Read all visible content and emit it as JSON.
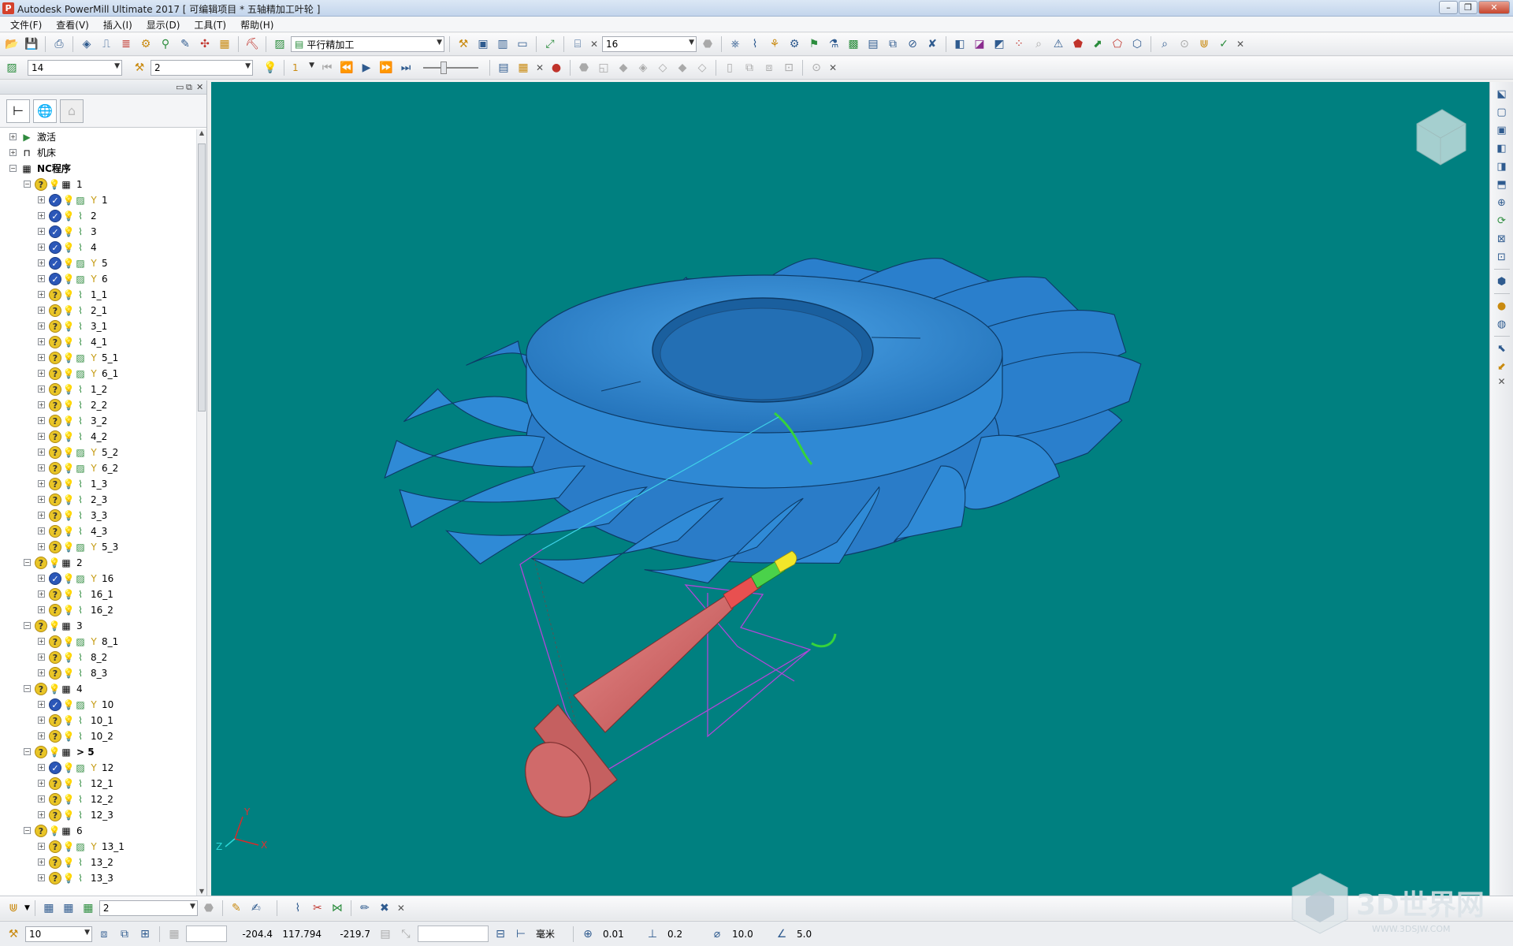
{
  "window": {
    "title": "Autodesk PowerMill Ultimate 2017   [ 可编辑项目 * 五轴精加工叶轮 ]",
    "app_icon": "P"
  },
  "menu": [
    "文件(F)",
    "查看(V)",
    "插入(I)",
    "显示(D)",
    "工具(T)",
    "帮助(H)"
  ],
  "toolbar1": {
    "strategy_combo": "平行精加工",
    "tool_combo": "16"
  },
  "toolbar2": {
    "toolpath_combo": "14",
    "level_combo": "2",
    "step_combo": "1"
  },
  "tree": [
    {
      "label": "激活",
      "level": 0,
      "type": "active"
    },
    {
      "label": "机床",
      "level": 0,
      "type": "machine"
    },
    {
      "label": "NC程序",
      "level": 0,
      "type": "ncroot",
      "bold": true
    },
    {
      "label": "1",
      "level": 1,
      "type": "folder"
    },
    {
      "label": "1",
      "level": 2,
      "type": "done",
      "tool": "y"
    },
    {
      "label": "2",
      "level": 2,
      "type": "done",
      "tool": "p"
    },
    {
      "label": "3",
      "level": 2,
      "type": "done",
      "tool": "p"
    },
    {
      "label": "4",
      "level": 2,
      "type": "done",
      "tool": "p"
    },
    {
      "label": "5",
      "level": 2,
      "type": "done",
      "tool": "y"
    },
    {
      "label": "6",
      "level": 2,
      "type": "done",
      "tool": "y"
    },
    {
      "label": "1_1",
      "level": 2,
      "type": "q",
      "tool": "p"
    },
    {
      "label": "2_1",
      "level": 2,
      "type": "q",
      "tool": "p"
    },
    {
      "label": "3_1",
      "level": 2,
      "type": "q",
      "tool": "p"
    },
    {
      "label": "4_1",
      "level": 2,
      "type": "q",
      "tool": "p"
    },
    {
      "label": "5_1",
      "level": 2,
      "type": "q",
      "tool": "y"
    },
    {
      "label": "6_1",
      "level": 2,
      "type": "q",
      "tool": "y"
    },
    {
      "label": "1_2",
      "level": 2,
      "type": "q",
      "tool": "p"
    },
    {
      "label": "2_2",
      "level": 2,
      "type": "q",
      "tool": "p"
    },
    {
      "label": "3_2",
      "level": 2,
      "type": "q",
      "tool": "p"
    },
    {
      "label": "4_2",
      "level": 2,
      "type": "q",
      "tool": "p"
    },
    {
      "label": "5_2",
      "level": 2,
      "type": "q",
      "tool": "y"
    },
    {
      "label": "6_2",
      "level": 2,
      "type": "q",
      "tool": "y"
    },
    {
      "label": "1_3",
      "level": 2,
      "type": "q",
      "tool": "p"
    },
    {
      "label": "2_3",
      "level": 2,
      "type": "q",
      "tool": "p"
    },
    {
      "label": "3_3",
      "level": 2,
      "type": "q",
      "tool": "p"
    },
    {
      "label": "4_3",
      "level": 2,
      "type": "q",
      "tool": "p"
    },
    {
      "label": "5_3",
      "level": 2,
      "type": "q",
      "tool": "y"
    },
    {
      "label": "2",
      "level": 1,
      "type": "folder"
    },
    {
      "label": "16",
      "level": 2,
      "type": "done",
      "tool": "y"
    },
    {
      "label": "16_1",
      "level": 2,
      "type": "q",
      "tool": "p"
    },
    {
      "label": "16_2",
      "level": 2,
      "type": "q",
      "tool": "p"
    },
    {
      "label": "3",
      "level": 1,
      "type": "folder"
    },
    {
      "label": "8_1",
      "level": 2,
      "type": "q",
      "tool": "y"
    },
    {
      "label": "8_2",
      "level": 2,
      "type": "q",
      "tool": "p"
    },
    {
      "label": "8_3",
      "level": 2,
      "type": "q",
      "tool": "p"
    },
    {
      "label": "4",
      "level": 1,
      "type": "folder"
    },
    {
      "label": "10",
      "level": 2,
      "type": "done",
      "tool": "y"
    },
    {
      "label": "10_1",
      "level": 2,
      "type": "q",
      "tool": "p"
    },
    {
      "label": "10_2",
      "level": 2,
      "type": "q",
      "tool": "p"
    },
    {
      "label": "> 5",
      "level": 1,
      "type": "folder",
      "bold": true
    },
    {
      "label": "12",
      "level": 2,
      "type": "done",
      "tool": "y"
    },
    {
      "label": "12_1",
      "level": 2,
      "type": "q",
      "tool": "p"
    },
    {
      "label": "12_2",
      "level": 2,
      "type": "q",
      "tool": "p"
    },
    {
      "label": "12_3",
      "level": 2,
      "type": "q",
      "tool": "p"
    },
    {
      "label": "6",
      "level": 1,
      "type": "folder"
    },
    {
      "label": "13_1",
      "level": 2,
      "type": "q",
      "tool": "y"
    },
    {
      "label": "13_2",
      "level": 2,
      "type": "q",
      "tool": "p"
    },
    {
      "label": "13_3",
      "level": 2,
      "type": "q",
      "tool": "p"
    }
  ],
  "viewport": {
    "background": "#008080",
    "part_color": "#2e86d0",
    "tool_color": "#d06a6a",
    "axes": {
      "y": "Y",
      "z": "Z",
      "x": "X"
    }
  },
  "bottom_toolbar": {
    "combo": "2"
  },
  "status": {
    "tolerance_combo": "10",
    "x": "-204.4",
    "y": "117.794",
    "z": "-219.7",
    "units": "毫米",
    "tol": "0.01",
    "stock": "0.2",
    "diameter": "10.0",
    "stepover": "5.0"
  },
  "watermark": {
    "text": "3D世界网",
    "url": "WWW.3DSJW.COM"
  }
}
